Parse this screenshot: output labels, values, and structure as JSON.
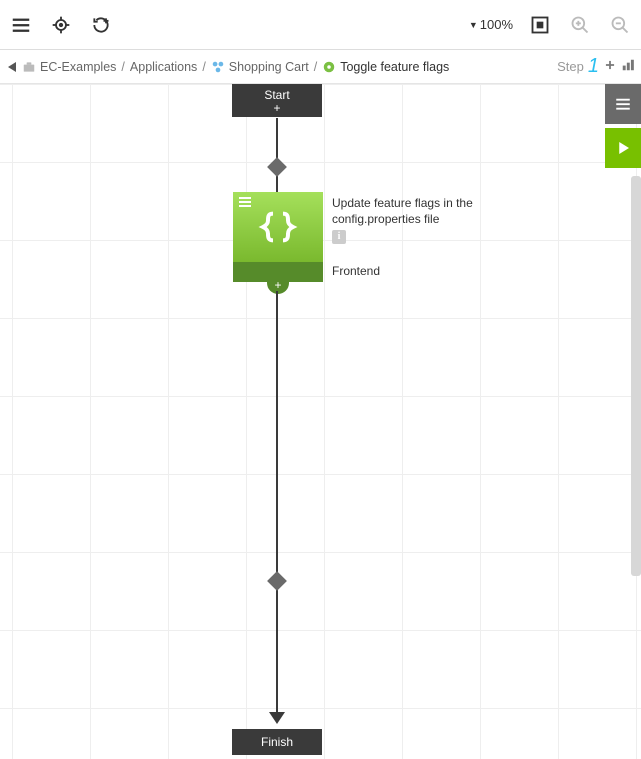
{
  "toolbar": {
    "zoom_level": "100%"
  },
  "breadcrumb": {
    "project": "EC-Examples",
    "level1": "Applications",
    "level2": "Shopping Cart",
    "level3": "Toggle feature flags"
  },
  "step": {
    "label": "Step",
    "number": "1"
  },
  "flow": {
    "start_label": "Start",
    "finish_label": "Finish",
    "process_title": "Update feature flags in the config.properties file",
    "process_component": "Frontend"
  }
}
